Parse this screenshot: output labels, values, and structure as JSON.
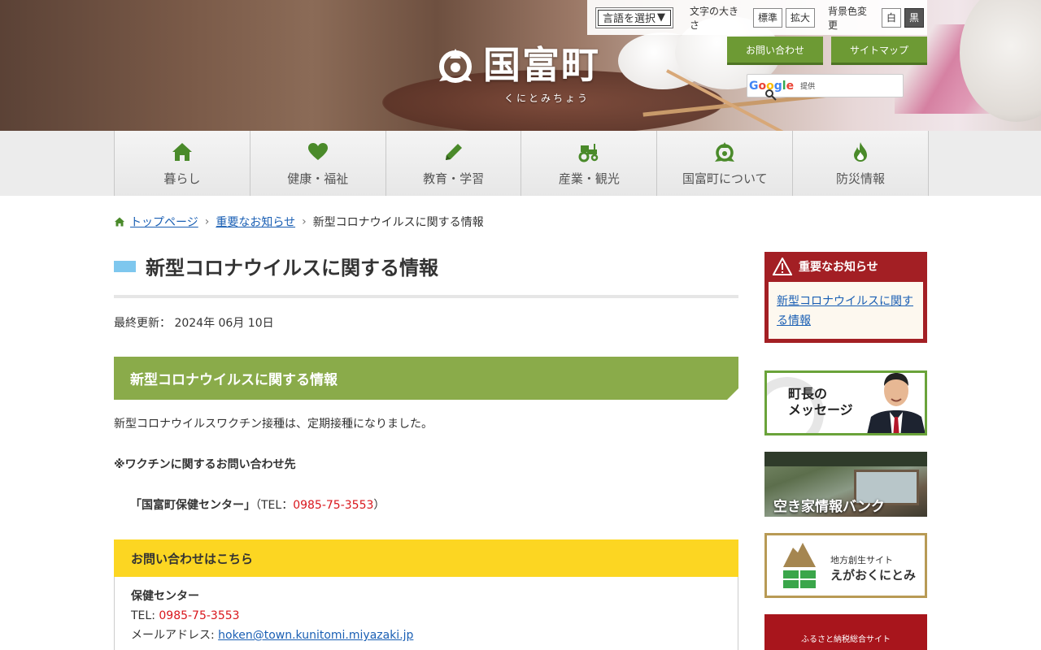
{
  "header": {
    "logo_text": "国富町",
    "logo_reading": "くにとみちょう",
    "language_select": "言語を選択",
    "font_size_label": "文字の大きさ",
    "font_standard": "標準",
    "font_large": "拡大",
    "bg_color_label": "背景色変更",
    "bg_white": "白",
    "bg_black": "黒",
    "contact_button": "お問い合わせ",
    "sitemap_button": "サイトマップ",
    "search_provided": "提供"
  },
  "nav": {
    "items": [
      {
        "label": "暮らし",
        "icon": "home-icon"
      },
      {
        "label": "健康・福祉",
        "icon": "heart-icon"
      },
      {
        "label": "教育・学習",
        "icon": "pencil-icon"
      },
      {
        "label": "産業・観光",
        "icon": "tractor-icon"
      },
      {
        "label": "国富町について",
        "icon": "town-emblem-icon"
      },
      {
        "label": "防災情報",
        "icon": "flame-icon"
      }
    ]
  },
  "breadcrumb": {
    "home": "トップページ",
    "parent": "重要なお知らせ",
    "current": "新型コロナウイルスに関する情報"
  },
  "main": {
    "title": "新型コロナウイルスに関する情報",
    "updated": "最終更新： 2024年 06月 10日",
    "section_title": "新型コロナウイルスに関する情報",
    "paragraph1": "新型コロナウイルスワクチン接種は、定期接種になりました。",
    "paragraph2": "※ワクチンに関するお問い合わせ先",
    "center_name": "「国富町保健センター」",
    "tel_prefix": "（TEL：",
    "tel": "0985-75-3553",
    "tel_suffix": "）"
  },
  "contact": {
    "heading": "お問い合わせはこちら",
    "dept": "保健センター",
    "tel_label": "TEL: ",
    "tel": "0985-75-3553",
    "mail_label": "メールアドレス: ",
    "mail": "hoken@town.kunitomi.miyazaki.jp"
  },
  "sidebar": {
    "important_heading": "重要なお知らせ",
    "important_link": "新型コロナウイルスに関する情報",
    "mayor_line1": "町長の",
    "mayor_line2": "メッセージ",
    "akiya": "空き家情報バンク",
    "egaoku_small": "地方創生サイト",
    "egaoku_big": "えがおくにとみ",
    "furusato": "ふるさと納税総合サイト"
  },
  "colors": {
    "nav_icon": "#4a8a2a",
    "green_button": "#6d9a34",
    "section_green": "#8aab4a",
    "contact_yellow": "#fcd622",
    "important_red": "#a31f24",
    "tel_red": "#d9161c",
    "title_bar_blue": "#7ec7ee"
  }
}
